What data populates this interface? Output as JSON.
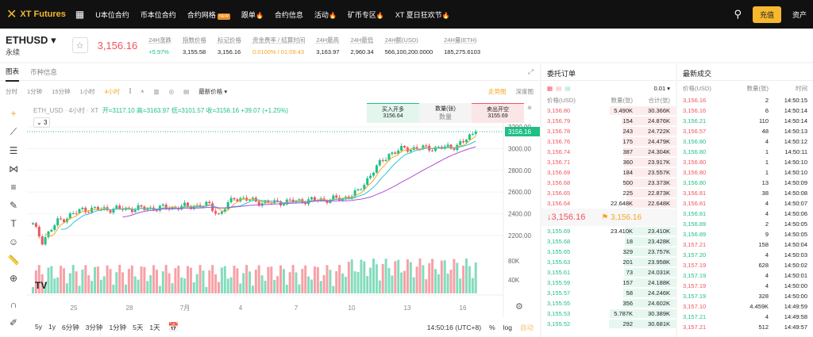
{
  "nav": {
    "brand": "XT Futures",
    "items": [
      "U本位合约",
      "币本位合约",
      "合约网格",
      "跟单",
      "合约信息",
      "活动",
      "矿币专区",
      "XT 夏日狂欢节"
    ],
    "new_badge": "NEW",
    "deposit": "充值",
    "assets": "资产"
  },
  "ticker": {
    "symbol": "ETHUSD",
    "type": "永续",
    "last": "3,156.16",
    "stats": [
      {
        "label": "24H涨跌",
        "value": "+5.97%"
      },
      {
        "label": "指数价格",
        "value": "3,155.58"
      },
      {
        "label": "标记价格",
        "value": "3,156.16"
      },
      {
        "label": "资金费率 / 结算时间",
        "value": "0.0100% / 01:09:43"
      },
      {
        "label": "24H最高",
        "value": "3,163.97"
      },
      {
        "label": "24H最低",
        "value": "2,960.34"
      },
      {
        "label": "24H额(USD)",
        "value": "566,100,200.0000"
      },
      {
        "label": "24H量(ETH)",
        "value": "185,275.6103"
      }
    ]
  },
  "chart": {
    "tabs": [
      "图表",
      "币种信息"
    ],
    "intervals": [
      "分时",
      "1分钟",
      "15分钟",
      "1小时",
      "4小时"
    ],
    "active_interval": "4小时",
    "price_type": "最新价格",
    "views": [
      "走势图",
      "深度图"
    ],
    "legend": {
      "title": "ETH_USD · 4小时 · XT",
      "ohlc": "开=3117.10 高=3163.97 低=3101.57 收=3156.16 +39.07 (+1.25%)"
    },
    "indicator_count": "3",
    "quick_trade": {
      "buy": "买入开多",
      "buy_price": "3156.64",
      "qty_label": "数量(张)",
      "qty_placeholder": "数量",
      "sell": "卖出开空",
      "sell_price": "3155.69"
    },
    "price_ticks": [
      "3200.00",
      "3000.00",
      "2800.00",
      "2600.00",
      "2400.00",
      "2200.00"
    ],
    "current_price_tag": "3156.16",
    "volume_ticks": [
      "80K",
      "40K"
    ],
    "date_ticks": [
      "25",
      "28",
      "7月",
      "4",
      "7",
      "10",
      "13",
      "16"
    ],
    "ranges": [
      "5y",
      "1y",
      "6分钟",
      "3分钟",
      "1分钟",
      "5天",
      "1天"
    ],
    "clock": "14:50:16 (UTC+8)",
    "pct": "%",
    "log": "log",
    "auto": "自动",
    "colors": {
      "up": "#1fbf86",
      "down": "#f0545d",
      "ma1": "#f5a623",
      "ma2": "#2ec5d6",
      "ma3": "#b04fd6"
    },
    "anchors": [
      [
        0,
        2300
      ],
      [
        3,
        2150
      ],
      [
        8,
        2330
      ],
      [
        16,
        2440
      ],
      [
        40,
        2450
      ],
      [
        57,
        2480
      ],
      [
        60,
        2390
      ],
      [
        65,
        2550
      ],
      [
        75,
        2500
      ],
      [
        100,
        2540
      ],
      [
        105,
        2600
      ],
      [
        110,
        2800
      ],
      [
        115,
        2950
      ],
      [
        120,
        3000
      ],
      [
        135,
        3010
      ],
      [
        139,
        3060
      ],
      [
        143,
        3156
      ]
    ]
  },
  "orderbook": {
    "title": "委托订单",
    "precision": "0.01",
    "headers": [
      "价格(USD)",
      "数量(张)",
      "合计(张)"
    ],
    "asks": [
      [
        "3,156.80",
        "5.490K",
        "30.366K"
      ],
      [
        "3,156.79",
        "154",
        "24.876K"
      ],
      [
        "3,156.78",
        "243",
        "24.722K"
      ],
      [
        "3,156.76",
        "175",
        "24.479K"
      ],
      [
        "3,156.74",
        "387",
        "24.304K"
      ],
      [
        "3,156.71",
        "360",
        "23.917K"
      ],
      [
        "3,156.69",
        "184",
        "23.557K"
      ],
      [
        "3,156.68",
        "500",
        "23.373K"
      ],
      [
        "3,156.65",
        "225",
        "22.873K"
      ],
      [
        "3,156.64",
        "22.648K",
        "22.648K"
      ]
    ],
    "last": "↓3,156.16",
    "mark": "3,156.16",
    "bids": [
      [
        "3,155.69",
        "23.410K",
        "23.410K"
      ],
      [
        "3,155.68",
        "18",
        "23.428K"
      ],
      [
        "3,155.65",
        "329",
        "23.757K"
      ],
      [
        "3,155.63",
        "201",
        "23.958K"
      ],
      [
        "3,155.61",
        "73",
        "24.031K"
      ],
      [
        "3,155.59",
        "157",
        "24.188K"
      ],
      [
        "3,155.57",
        "58",
        "24.246K"
      ],
      [
        "3,155.55",
        "356",
        "24.602K"
      ],
      [
        "3,155.53",
        "5.787K",
        "30.389K"
      ],
      [
        "3,155.52",
        "292",
        "30.681K"
      ]
    ]
  },
  "trades": {
    "title": "最新成交",
    "headers": [
      "价格(USD)",
      "数量(张)",
      "时间"
    ],
    "rows": [
      [
        "3,156.16",
        "2",
        "14:50:15",
        "d"
      ],
      [
        "3,156.16",
        "6",
        "14:50:14",
        "d"
      ],
      [
        "3,156.21",
        "110",
        "14:50:14",
        "u"
      ],
      [
        "3,156.57",
        "48",
        "14:50:13",
        "d"
      ],
      [
        "3,156.80",
        "4",
        "14:50:12",
        "u"
      ],
      [
        "3,156.80",
        "1",
        "14:50:11",
        "u"
      ],
      [
        "3,156.80",
        "1",
        "14:50:10",
        "d"
      ],
      [
        "3,156.80",
        "1",
        "14:50:10",
        "d"
      ],
      [
        "3,156.80",
        "13",
        "14:50:09",
        "u"
      ],
      [
        "3,156.81",
        "38",
        "14:50:08",
        "d"
      ],
      [
        "3,156.81",
        "4",
        "14:50:07",
        "d"
      ],
      [
        "3,156.81",
        "4",
        "14:50:06",
        "u"
      ],
      [
        "3,156.89",
        "2",
        "14:50:05",
        "u"
      ],
      [
        "3,156.89",
        "9",
        "14:50:05",
        "u"
      ],
      [
        "3,157.21",
        "158",
        "14:50:04",
        "d"
      ],
      [
        "3,157.20",
        "4",
        "14:50:03",
        "u"
      ],
      [
        "3,157.19",
        "628",
        "14:50:02",
        "d"
      ],
      [
        "3,157.19",
        "4",
        "14:50:01",
        "u"
      ],
      [
        "3,157.19",
        "4",
        "14:50:00",
        "d"
      ],
      [
        "3,157.19",
        "328",
        "14:50:00",
        "u"
      ],
      [
        "3,157.10",
        "4.459K",
        "14:49:59",
        "d"
      ],
      [
        "3,157.21",
        "4",
        "14:49:58",
        "u"
      ],
      [
        "3,157.21",
        "512",
        "14:49:57",
        "d"
      ]
    ]
  }
}
